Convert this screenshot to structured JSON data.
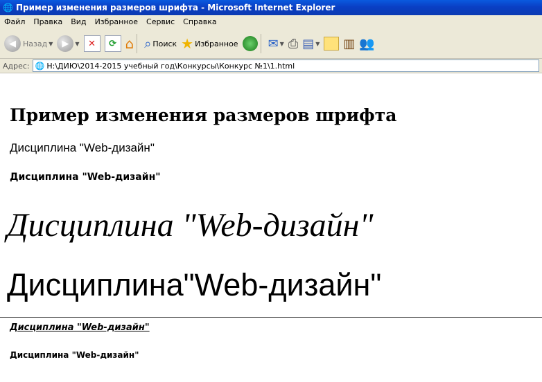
{
  "window": {
    "title": "Пример изменения размеров шрифта - Microsoft Internet Explorer"
  },
  "menu": [
    "Файл",
    "Правка",
    "Вид",
    "Избранное",
    "Сервис",
    "Справка"
  ],
  "toolbar": {
    "back_label": "Назад",
    "search_label": "Поиск",
    "favorites_label": "Избранное"
  },
  "address": {
    "label": "Адрес:",
    "value": "H:\\ДИЮ\\2014-2015 учебный год\\Конкурсы\\Конкурс №1\\1.html"
  },
  "page": {
    "heading": "Пример изменения размеров шрифта",
    "line1": "Дисциплина \"Web-дизайн\"",
    "line2": "Дисциплина \"Web-дизайн\"",
    "line3": "Дисциплина \"Web-дизайн\"",
    "line4": "Дисциплина\"Web-дизайн\"",
    "line5": "Дисциплина \"Web-дизайн\"",
    "line6": "Дисциплина \"Web-дизайн\""
  }
}
